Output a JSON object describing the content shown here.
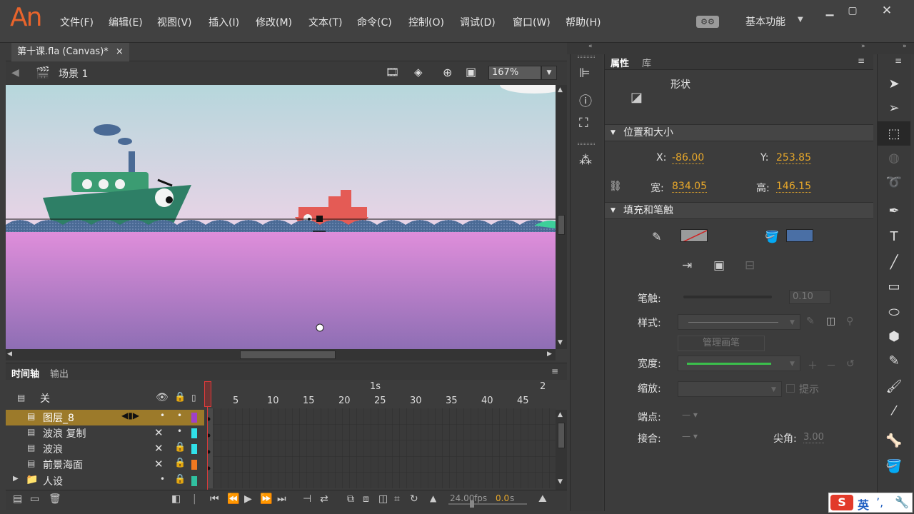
{
  "app": {
    "logo": "An"
  },
  "menu": [
    "文件(F)",
    "编辑(E)",
    "视图(V)",
    "插入(I)",
    "修改(M)",
    "文本(T)",
    "命令(C)",
    "控制(O)",
    "调试(D)",
    "窗口(W)",
    "帮助(H)"
  ],
  "workspace": {
    "label": "基本功能"
  },
  "document": {
    "tab_title": "第十课.fla (Canvas)*",
    "close": "×"
  },
  "editbar": {
    "scene": "场景 1",
    "zoom": "167%"
  },
  "timeline": {
    "tabs": [
      "时间轴",
      "输出"
    ],
    "header_label": "关",
    "time_marker": "1s",
    "time_marker_2": "2",
    "frame_numbers": [
      "5",
      "10",
      "15",
      "20",
      "25",
      "30",
      "35",
      "40",
      "45"
    ],
    "layers": [
      {
        "name": "图层_8",
        "selected": true,
        "color": "#a040c8"
      },
      {
        "name": "波浪 复制",
        "selected": false,
        "color": "#30e0e8"
      },
      {
        "name": "波浪",
        "selected": false,
        "color": "#30e0e8"
      },
      {
        "name": "前景海面",
        "selected": false,
        "color": "#f07820"
      },
      {
        "name": "人设",
        "selected": false,
        "folder": true,
        "color": "#30c0a0"
      }
    ],
    "fps": "24.00",
    "fps_unit": "fps",
    "time": "0.0",
    "time_unit": "s"
  },
  "properties": {
    "tabs": [
      "属性",
      "库"
    ],
    "object_type": "形状",
    "section_position": "位置和大小",
    "x_label": "X:",
    "x_value": "-86.00",
    "y_label": "Y:",
    "y_value": "253.85",
    "w_label": "宽:",
    "w_value": "834.05",
    "h_label": "高:",
    "h_value": "146.15",
    "section_fill": "填充和笔触",
    "stroke_label": "笔触:",
    "stroke_value": "0.10",
    "style_label": "样式:",
    "manage_brush": "管理画笔",
    "width_label": "宽度:",
    "scale_label": "缩放:",
    "hint_label": "提示",
    "cap_label": "端点:",
    "join_label": "接合:",
    "miter_label": "尖角:",
    "miter_value": "3.00",
    "fill_color": "#4a6fa5"
  },
  "ime": {
    "lang": "英"
  }
}
